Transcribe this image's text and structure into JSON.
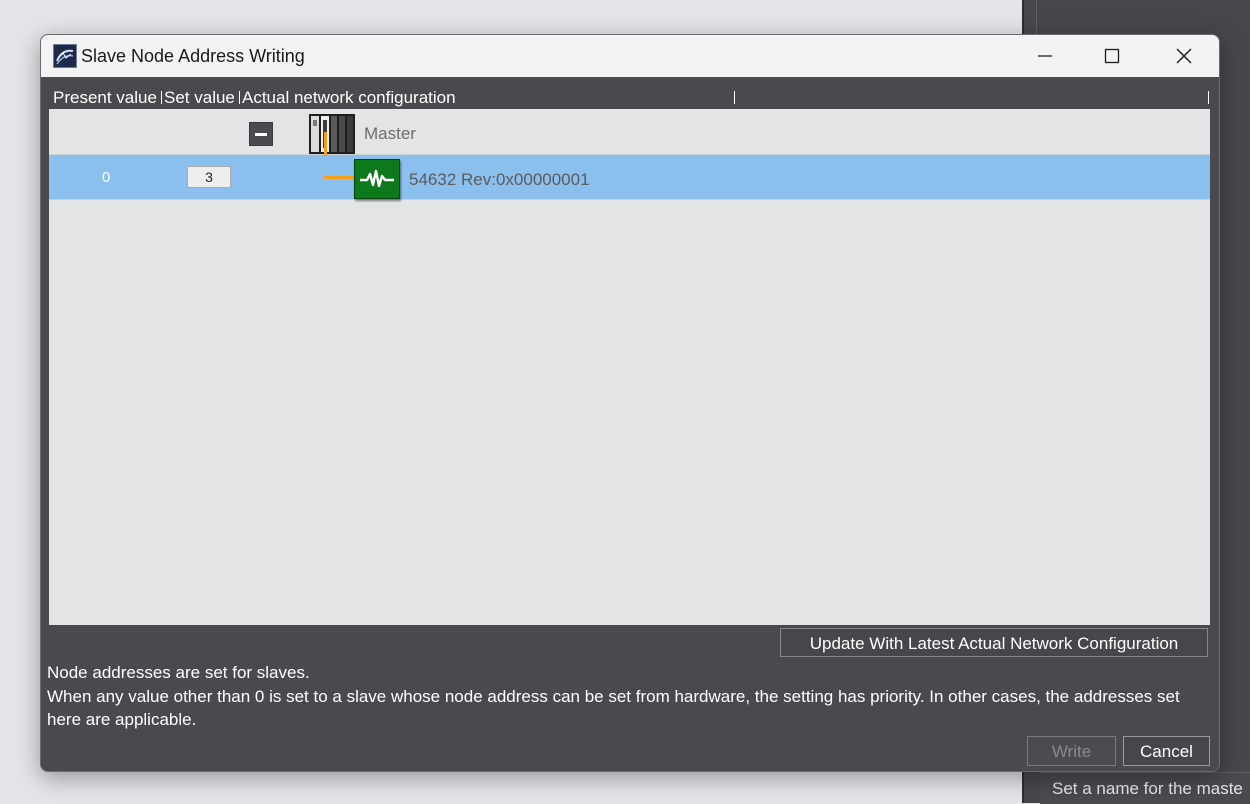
{
  "dialog": {
    "title": "Slave Node Address Writing",
    "icon": "app-icon",
    "window_controls": [
      "minimize-icon",
      "maximize-icon",
      "close-icon"
    ]
  },
  "grid": {
    "columns": [
      "Present value",
      "Set value",
      "Actual network configuration"
    ],
    "rows": [
      {
        "type": "master",
        "present_value": "",
        "set_value": "",
        "name": "Master",
        "expanded": true
      },
      {
        "type": "slave",
        "present_value": "0",
        "set_value": "3",
        "name": "54632 Rev:0x00000001",
        "selected": true
      }
    ]
  },
  "buttons": {
    "update": "Update With Latest Actual Network Configuration",
    "write": "Write",
    "cancel": "Cancel"
  },
  "info": {
    "line1": "Node addresses are set for slaves.",
    "line2": "When any value other than 0 is set to a slave whose node address can be set from hardware, the setting has priority. In other cases, the addresses set here are applicable."
  },
  "background": {
    "status_text": "Set a name for the maste"
  },
  "colors": {
    "dialog_bg": "#4a4a4e",
    "selected_row": "#8bbfee",
    "connector": "#f2a01c",
    "slave_icon": "#0c7a1a"
  }
}
